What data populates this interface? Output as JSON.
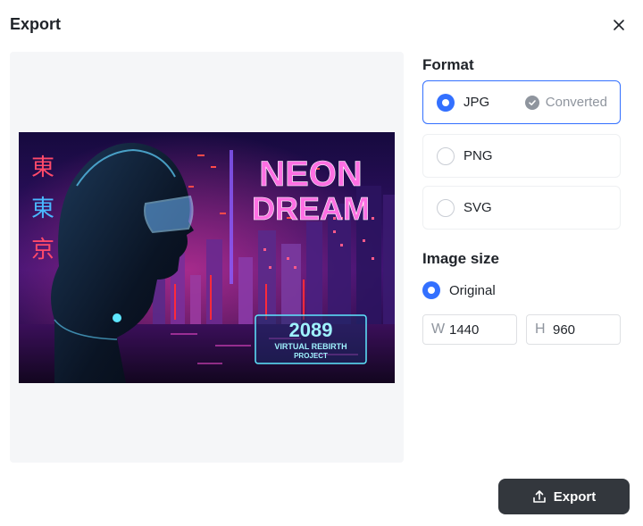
{
  "dialog": {
    "title": "Export"
  },
  "preview": {
    "image": {
      "headline_line1": "NEON",
      "headline_line2": "DREAM",
      "year": "2089",
      "subtitle_line1": "VIRTUAL REBIRTH",
      "subtitle_line2": "PROJECT",
      "vertical_chars": [
        "東",
        "東",
        "京"
      ]
    }
  },
  "format": {
    "title": "Format",
    "options": [
      {
        "label": "JPG",
        "selected": true,
        "status": "Converted"
      },
      {
        "label": "PNG",
        "selected": false
      },
      {
        "label": "SVG",
        "selected": false
      }
    ]
  },
  "image_size": {
    "title": "Image size",
    "option_label": "Original",
    "width_prefix": "W",
    "width_value": "1440",
    "height_prefix": "H",
    "height_value": "960"
  },
  "footer": {
    "export_label": "Export"
  },
  "colors": {
    "accent": "#3370ff",
    "button_bg": "#33373d",
    "neon_pink": "#ff4fd8",
    "neon_cyan": "#5ee7ff"
  },
  "icons": {
    "close": "close-icon",
    "converted": "check-circle-icon",
    "export": "upload-icon"
  }
}
